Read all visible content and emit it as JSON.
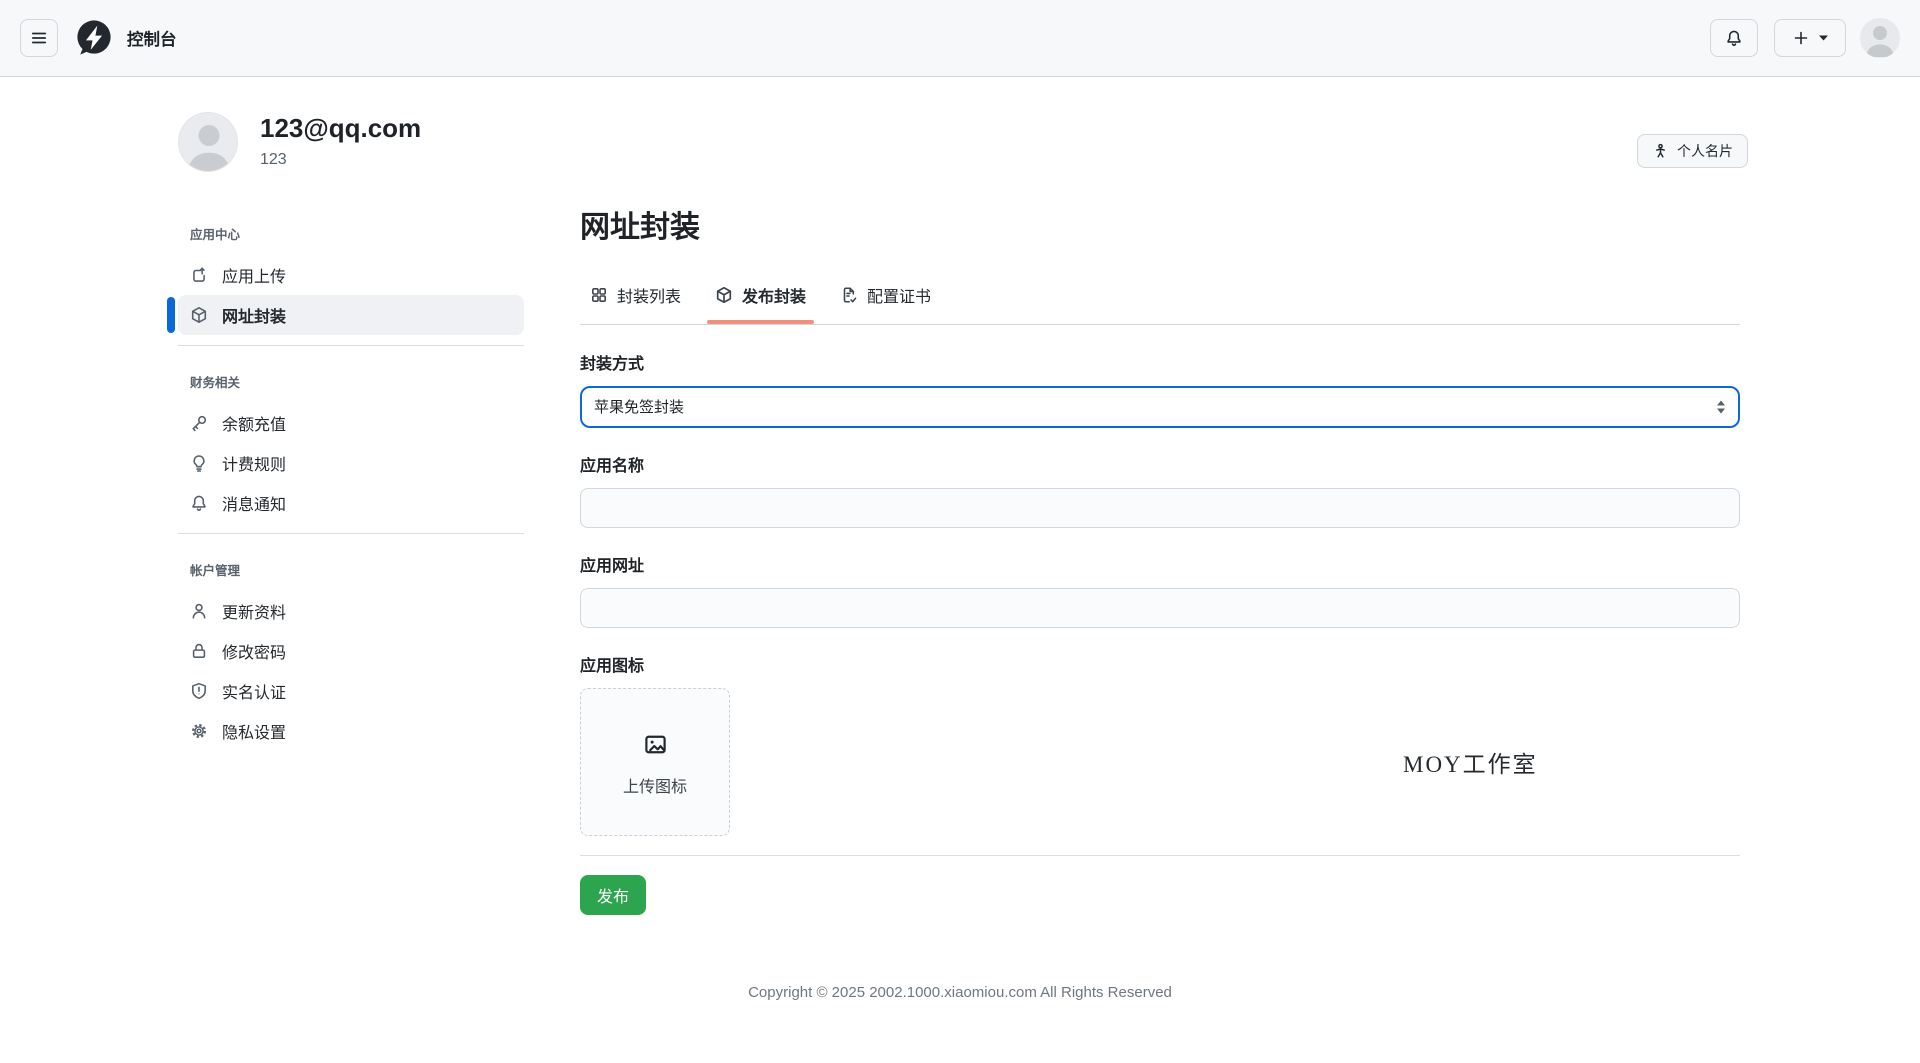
{
  "header": {
    "title": "控制台",
    "icons": [
      "hamburger-icon",
      "logo-bolt-icon",
      "bell-icon",
      "plus-icon",
      "caret-down-icon",
      "avatar"
    ]
  },
  "profile": {
    "email": "123@qq.com",
    "username": "123",
    "card_button_label": "个人名片"
  },
  "sidebar": {
    "sections": [
      {
        "heading": "应用中心",
        "items": [
          {
            "label": "应用上传",
            "icon": "upload-icon",
            "active": false
          },
          {
            "label": "网址封装",
            "icon": "package-icon",
            "active": true
          }
        ]
      },
      {
        "heading": "财务相关",
        "items": [
          {
            "label": "余额充值",
            "icon": "key-icon",
            "active": false
          },
          {
            "label": "计费规则",
            "icon": "lightbulb-icon",
            "active": false
          },
          {
            "label": "消息通知",
            "icon": "bell-icon",
            "active": false
          }
        ]
      },
      {
        "heading": "帐户管理",
        "items": [
          {
            "label": "更新资料",
            "icon": "person-icon",
            "active": false
          },
          {
            "label": "修改密码",
            "icon": "lock-icon",
            "active": false
          },
          {
            "label": "实名认证",
            "icon": "shield-icon",
            "active": false
          },
          {
            "label": "隐私设置",
            "icon": "gear-icon",
            "active": false
          }
        ]
      }
    ]
  },
  "main": {
    "title": "网址封装",
    "tabs": [
      {
        "label": "封装列表",
        "icon": "grid-icon",
        "active": false
      },
      {
        "label": "发布封装",
        "icon": "package-icon",
        "active": true
      },
      {
        "label": "配置证书",
        "icon": "file-check-icon",
        "active": false
      }
    ],
    "form": {
      "method_label": "封装方式",
      "method_value": "苹果免签封装",
      "name_label": "应用名称",
      "name_value": "",
      "url_label": "应用网址",
      "url_value": "",
      "icon_label": "应用图标",
      "upload_text": "上传图标",
      "submit_label": "发布"
    },
    "watermark": "MOY工作室"
  },
  "footer": {
    "copyright": "Copyright © 2025 2002.1000.xiaomiou.com All Rights Reserved"
  },
  "colors": {
    "accent_blue": "#0969da",
    "tab_underline": "#f0917e",
    "button_green": "#2da44e",
    "header_bg": "#f6f8fa"
  }
}
